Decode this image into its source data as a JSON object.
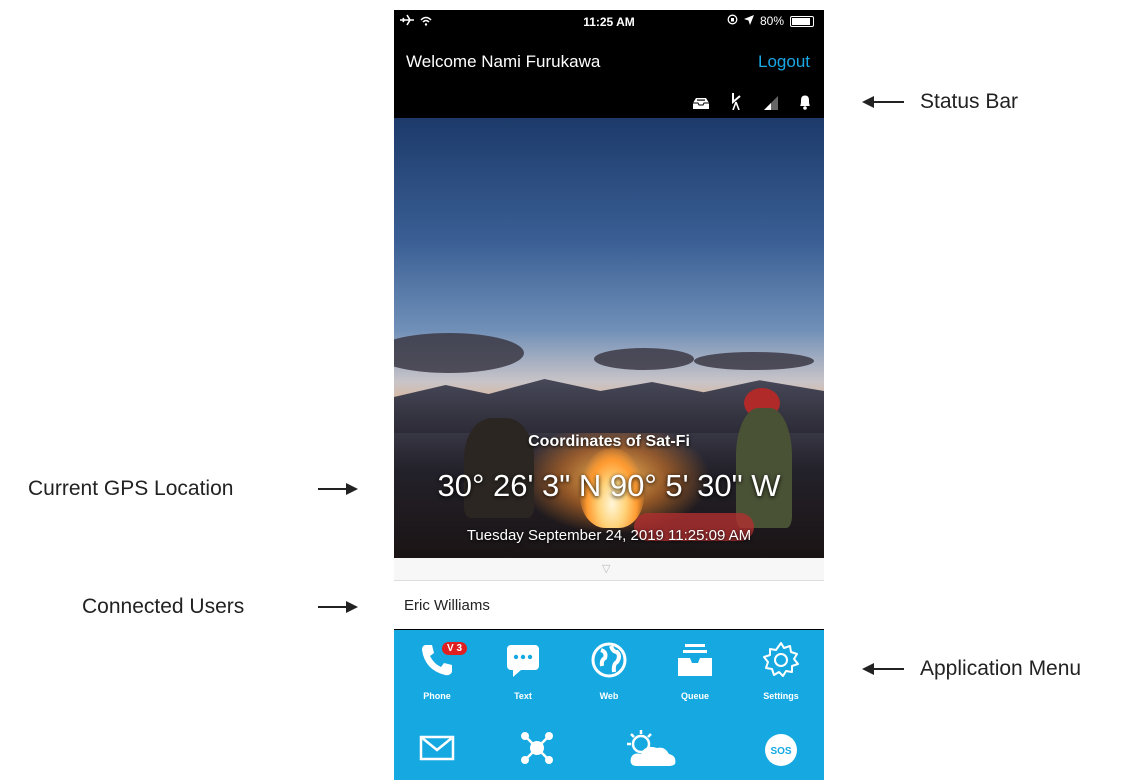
{
  "ios_status": {
    "time": "11:25 AM",
    "battery": "80%"
  },
  "header": {
    "welcome": "Welcome Nami Furukawa",
    "logout_label": "Logout"
  },
  "status_icons": [
    "inbox-icon",
    "satellite-icon",
    "signal-icon",
    "bell-icon"
  ],
  "hero": {
    "coordinates_title": "Coordinates of Sat-Fi",
    "coordinates": "30° 26' 3\" N  90° 5' 30\" W",
    "datetime": "Tuesday September 24, 2019 11:25:09 AM"
  },
  "connected_users": [
    "Eric Williams"
  ],
  "app_menu": {
    "row1": [
      {
        "label": "Phone",
        "icon": "phone-icon",
        "badge": "V 3"
      },
      {
        "label": "Text",
        "icon": "chat-icon"
      },
      {
        "label": "Web",
        "icon": "globe-icon"
      },
      {
        "label": "Queue",
        "icon": "queue-tray-icon"
      },
      {
        "label": "Settings",
        "icon": "gear-icon"
      }
    ],
    "row2": [
      {
        "icon": "mail-icon"
      },
      {
        "icon": "network-icon"
      },
      {
        "icon": "weather-icon"
      },
      {
        "icon": "sos-icon",
        "text": "SOS"
      }
    ]
  },
  "annotations": {
    "status_bar": "Status Bar",
    "gps": "Current GPS Location",
    "users": "Connected Users",
    "menu": "Application Menu"
  },
  "colors": {
    "menu_bg": "#16a9e1",
    "logout": "#1aa7e6",
    "badge": "#e02020"
  }
}
